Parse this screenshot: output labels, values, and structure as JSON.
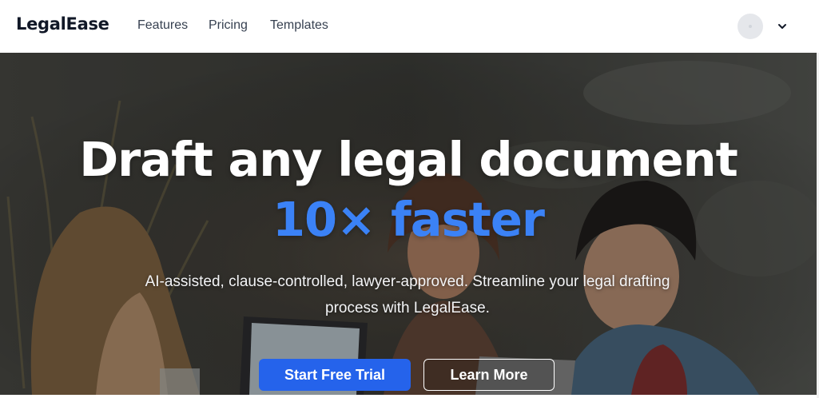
{
  "header": {
    "brand": "LegalEase",
    "nav": [
      {
        "label": "Features"
      },
      {
        "label": "Pricing"
      },
      {
        "label": "Templates"
      }
    ]
  },
  "hero": {
    "headline": "Draft any legal document",
    "headline_accent": "10× faster",
    "subtitle": "AI-assisted, clause-controlled, lawyer-approved. Streamline your legal drafting process with LegalEase.",
    "primary_cta": "Start Free Trial",
    "secondary_cta": "Learn More"
  },
  "colors": {
    "accent": "#3b82f6",
    "primary_button": "#2563eb"
  },
  "icons": {
    "avatar": "user-avatar-icon",
    "chevron": "chevron-down-icon"
  }
}
